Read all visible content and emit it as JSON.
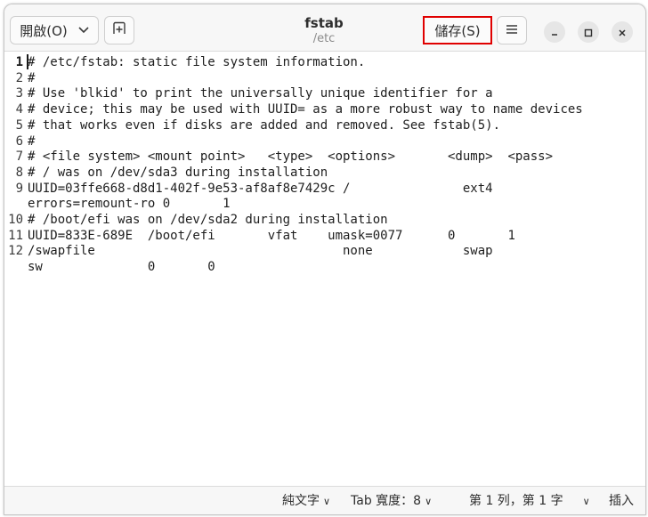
{
  "header": {
    "open_label": "開啟(O)",
    "title": "fstab",
    "subtitle": "/etc",
    "save_label": "儲存(S)"
  },
  "editor": {
    "current_line": 1,
    "lines": [
      {
        "num": "1",
        "text": "# /etc/fstab: static file system information."
      },
      {
        "num": "2",
        "text": "#"
      },
      {
        "num": "3",
        "text": "# Use 'blkid' to print the universally unique identifier for a"
      },
      {
        "num": "4",
        "text": "# device; this may be used with UUID= as a more robust way to name devices"
      },
      {
        "num": "5",
        "text": "# that works even if disks are added and removed. See fstab(5)."
      },
      {
        "num": "6",
        "text": "#"
      },
      {
        "num": "7",
        "text": "# <file system> <mount point>   <type>  <options>       <dump>  <pass>"
      },
      {
        "num": "8",
        "text": "# / was on /dev/sda3 during installation"
      },
      {
        "num": "9",
        "text": "UUID=03ffe668-d8d1-402f-9e53-af8af8e7429c /               ext4"
      },
      {
        "num": "",
        "text": "errors=remount-ro 0       1"
      },
      {
        "num": "10",
        "text": "# /boot/efi was on /dev/sda2 during installation"
      },
      {
        "num": "11",
        "text": "UUID=833E-689E  /boot/efi       vfat    umask=0077      0       1"
      },
      {
        "num": "12",
        "text": "/swapfile                                 none            swap"
      },
      {
        "num": "",
        "text": "sw              0       0"
      }
    ]
  },
  "status": {
    "syntax": "純文字",
    "tab_width": "Tab 寬度：8",
    "position": "第 1 列，第 1 字",
    "mode": "插入"
  },
  "icons": {
    "open_dropdown": "chevron-down-icon",
    "new_tab": "new-tab-icon",
    "menu": "hamburger-menu-icon",
    "minimize": "minimize-icon",
    "maximize": "maximize-icon",
    "close": "close-icon"
  },
  "colors": {
    "highlight_border": "#e00000"
  }
}
